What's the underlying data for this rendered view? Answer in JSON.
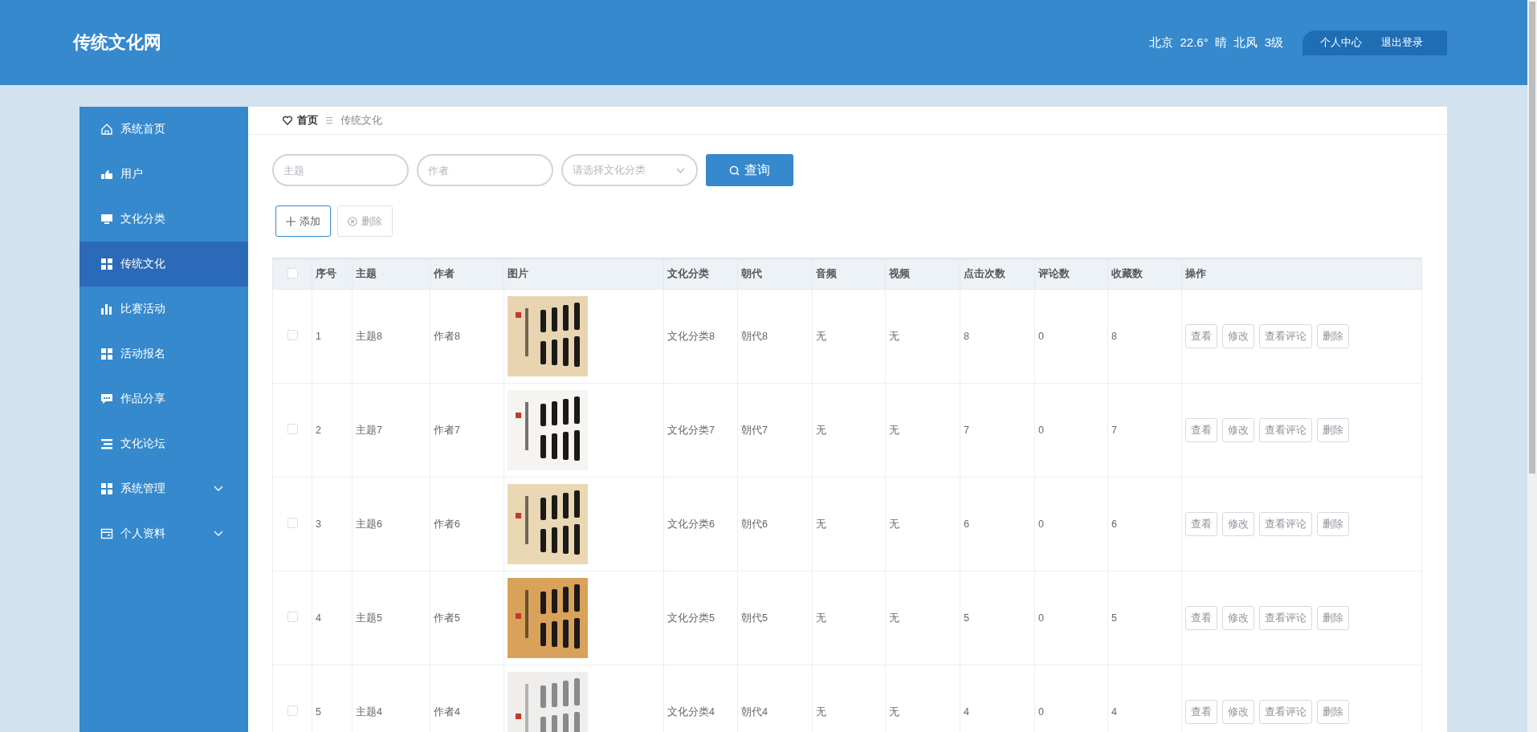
{
  "header": {
    "title": "传统文化网",
    "weather": "北京  22.6°  晴  北风  3级",
    "links": [
      "个人中心",
      "退出登录"
    ]
  },
  "sidebar": {
    "items": [
      {
        "label": "系统首页",
        "kind": "link",
        "selected": false
      },
      {
        "label": "用户",
        "kind": "link",
        "selected": false
      },
      {
        "label": "文化分类",
        "kind": "link",
        "selected": false
      },
      {
        "label": "传统文化",
        "kind": "link",
        "selected": true
      },
      {
        "label": "比赛活动",
        "kind": "link",
        "selected": false
      },
      {
        "label": "活动报名",
        "kind": "link",
        "selected": false
      },
      {
        "label": "作品分享",
        "kind": "link",
        "selected": false
      },
      {
        "label": "文化论坛",
        "kind": "link",
        "selected": false
      },
      {
        "label": "系统管理",
        "kind": "group",
        "expanded": false,
        "selected": false
      },
      {
        "label": "个人资料",
        "kind": "group",
        "expanded": false,
        "selected": false
      }
    ]
  },
  "breadcrumb": [
    "首页",
    "传统文化"
  ],
  "search": {
    "fields": [
      {
        "placeholder": "主题"
      },
      {
        "placeholder": "作者"
      }
    ],
    "select": {
      "placeholder": "请选择文化分类"
    },
    "button": "查询"
  },
  "actions": [
    {
      "label": "添加",
      "kind": "add",
      "disabled": false
    },
    {
      "label": "删除",
      "kind": "delete",
      "disabled": true
    }
  ],
  "table": {
    "all_checked": false,
    "columns": [
      "序号",
      "主题",
      "作者",
      "图片",
      "文化分类",
      "朝代",
      "音频",
      "视频",
      "点击次数",
      "评论数",
      "收藏数",
      "操作"
    ],
    "rows": [
      {
        "checked": false,
        "cells": [
          "1",
          "主题8",
          "作者8",
          {
            "kind": "picture"
          },
          "文化分类8",
          "朝代8",
          "无",
          "无",
          "8",
          "0",
          "8"
        ],
        "actions": [
          "查看",
          "修改",
          "查看评论",
          "删除"
        ]
      },
      {
        "checked": false,
        "cells": [
          "2",
          "主题7",
          "作者7",
          {
            "kind": "picture"
          },
          "文化分类7",
          "朝代7",
          "无",
          "无",
          "7",
          "0",
          "7"
        ],
        "actions": [
          "查看",
          "修改",
          "查看评论",
          "删除"
        ]
      },
      {
        "checked": false,
        "cells": [
          "3",
          "主题6",
          "作者6",
          {
            "kind": "picture"
          },
          "文化分类6",
          "朝代6",
          "无",
          "无",
          "6",
          "0",
          "6"
        ],
        "actions": [
          "查看",
          "修改",
          "查看评论",
          "删除"
        ]
      },
      {
        "checked": false,
        "cells": [
          "4",
          "主题5",
          "作者5",
          {
            "kind": "picture"
          },
          "文化分类5",
          "朝代5",
          "无",
          "无",
          "5",
          "0",
          "5"
        ],
        "actions": [
          "查看",
          "修改",
          "查看评论",
          "删除"
        ]
      },
      {
        "checked": false,
        "cells": [
          "5",
          "主题4",
          "作者4",
          {
            "kind": "picture"
          },
          "文化分类4",
          "朝代4",
          "无",
          "无",
          "4",
          "0",
          "4"
        ],
        "actions": [
          "查看",
          "修改",
          "查看评论",
          "删除"
        ]
      }
    ]
  }
}
